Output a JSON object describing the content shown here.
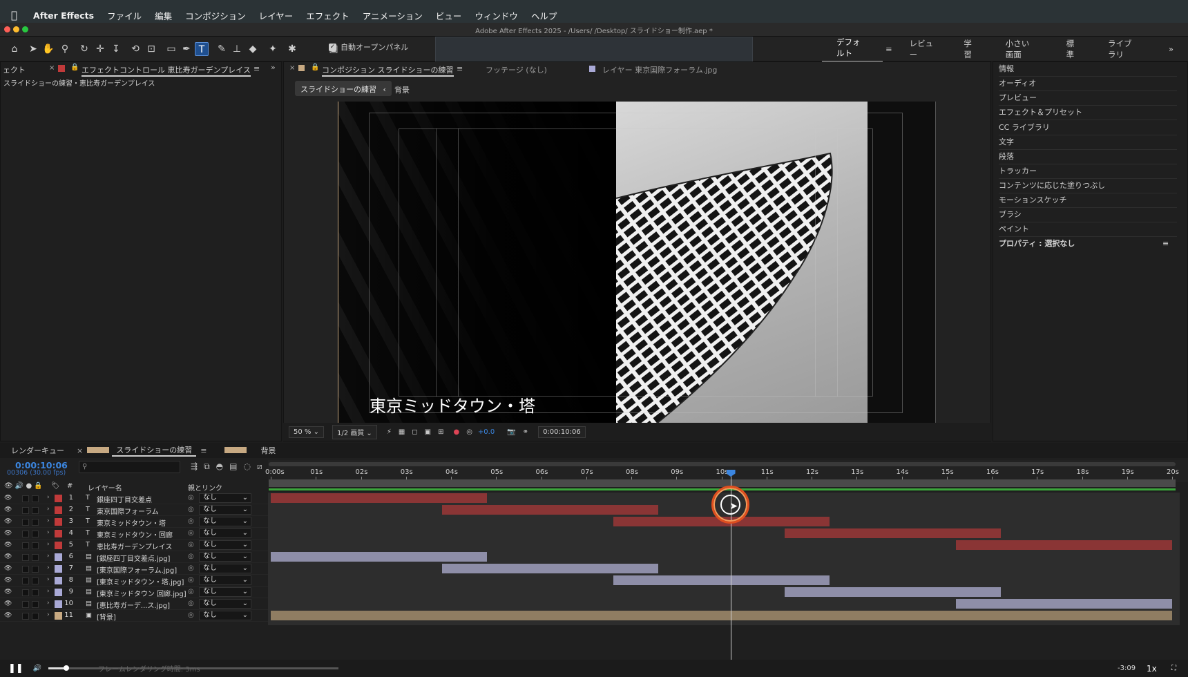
{
  "menubar": {
    "apple": "",
    "app": "After Effects",
    "items": [
      "ファイル",
      "編集",
      "コンポジション",
      "レイヤー",
      "エフェクト",
      "アニメーション",
      "ビュー",
      "ウィンドウ",
      "ヘルプ"
    ]
  },
  "window": {
    "title": "Adobe After Effects 2025 - /Users/          /Desktop/       スライドショー制作.aep *"
  },
  "toolbar": {
    "auto_open_panel": "自動オープンパネル",
    "auto_open_checked": true,
    "tools": [
      "home-icon",
      "selection-icon",
      "hand-icon",
      "zoom-icon",
      "orbit-icon",
      "track-xy-icon",
      "track-z-icon",
      "rotate-icon",
      "anchor-icon",
      "rectangle-icon",
      "pen-icon",
      "type-icon",
      "brush-icon",
      "clone-icon",
      "eraser-icon",
      "roto-icon",
      "puppet-icon"
    ],
    "active_tool": "type-icon"
  },
  "workspaces": {
    "items": [
      "デフォルト",
      "レビュー",
      "学習",
      "小さい画面",
      "標準",
      "ライブラリ"
    ],
    "current": "デフォルト",
    "more": "»"
  },
  "left_panel": {
    "tab_prev": "ェクト",
    "tab": "エフェクトコントロール 恵比寿ガーデンプレイス",
    "breadcrumb": "スライドショーの練習・恵比寿ガーデンプレイス"
  },
  "comp_panel": {
    "tab_comp": "コンポジション スライドショーの練習",
    "tab_footage": "フッテージ (なし)",
    "tab_layer": "レイヤー 東京国際フォーラム.jpg",
    "nav_current": "スライドショーの練習",
    "nav_next": "背景",
    "caption": "東京ミッドタウン・塔",
    "zoom": "50 %",
    "quality": "1/2 画質",
    "exposure": "+0.0",
    "timecode": "0:00:10:06"
  },
  "right_panel": {
    "items": [
      "情報",
      "オーディオ",
      "プレビュー",
      "エフェクト＆プリセット",
      "CC ライブラリ",
      "文字",
      "段落",
      "トラッカー",
      "コンテンツに応じた塗りつぶし",
      "モーションスケッチ",
      "ブラシ",
      "ペイント"
    ],
    "properties": "プロパティ : 選択なし"
  },
  "timeline": {
    "tab_render": "レンダーキュー",
    "tab_comp": "スライドショーの練習",
    "tab_bg": "背景",
    "timecode": "0:00:10:06",
    "fps": "00306 (30.00 fps)",
    "search_placeholder": "",
    "col_name": "レイヤー名",
    "col_parent": "親とリンク",
    "col_hash": "#",
    "ruler": [
      "0:00s",
      "01s",
      "02s",
      "03s",
      "04s",
      "05s",
      "06s",
      "07s",
      "08s",
      "09s",
      "10s",
      "11s",
      "12s",
      "13s",
      "14s",
      "15s",
      "16s",
      "17s",
      "18s",
      "19s",
      "20s"
    ],
    "playhead_seconds": 10.2,
    "duration_seconds": 20,
    "layers": [
      {
        "num": "1",
        "type": "T",
        "name": "銀座四丁目交差点",
        "parent": "なし",
        "color": "#c03a3a",
        "bar_color": "#8a3535",
        "in": 0,
        "out": 4.8
      },
      {
        "num": "2",
        "type": "T",
        "name": "東京国際フォーラム",
        "parent": "なし",
        "color": "#c03a3a",
        "bar_color": "#8a3535",
        "in": 3.8,
        "out": 8.6
      },
      {
        "num": "3",
        "type": "T",
        "name": "東京ミッドタウン・塔",
        "parent": "なし",
        "color": "#c03a3a",
        "bar_color": "#8a3535",
        "in": 7.6,
        "out": 12.4
      },
      {
        "num": "4",
        "type": "T",
        "name": "東京ミッドタウン・回廊",
        "parent": "なし",
        "color": "#c03a3a",
        "bar_color": "#8a3535",
        "in": 11.4,
        "out": 16.2
      },
      {
        "num": "5",
        "type": "T",
        "name": "恵比寿ガーデンプレイス",
        "parent": "なし",
        "color": "#c03a3a",
        "bar_color": "#8a3535",
        "in": 15.2,
        "out": 20
      },
      {
        "num": "6",
        "type": "img",
        "name": "[銀座四丁目交差点.jpg]",
        "parent": "なし",
        "color": "#a9a9d6",
        "bar_color": "#8e8ea8",
        "in": 0,
        "out": 4.8
      },
      {
        "num": "7",
        "type": "img",
        "name": "[東京国際フォーラム.jpg]",
        "parent": "なし",
        "color": "#a9a9d6",
        "bar_color": "#8e8ea8",
        "in": 3.8,
        "out": 8.6
      },
      {
        "num": "8",
        "type": "img",
        "name": "[東京ミッドタウン・塔.jpg]",
        "parent": "なし",
        "color": "#a9a9d6",
        "bar_color": "#8e8ea8",
        "in": 7.6,
        "out": 12.4
      },
      {
        "num": "9",
        "type": "img",
        "name": "[東京ミッドタウン 回廊.jpg]",
        "parent": "なし",
        "color": "#a9a9d6",
        "bar_color": "#8e8ea8",
        "in": 11.4,
        "out": 16.2
      },
      {
        "num": "10",
        "type": "img",
        "name": "[恵比寿ガーデ...ス.jpg]",
        "parent": "なし",
        "color": "#a9a9d6",
        "bar_color": "#8e8ea8",
        "in": 15.2,
        "out": 20
      },
      {
        "num": "11",
        "type": "comp",
        "name": "[背景]",
        "parent": "なし",
        "color": "#c7a982",
        "bar_color": "#8f7d62",
        "in": 0,
        "out": 20
      }
    ],
    "render_time": "フレームレンダリング時間: 3ms",
    "end_time": "-3:09",
    "speed": "1x"
  }
}
